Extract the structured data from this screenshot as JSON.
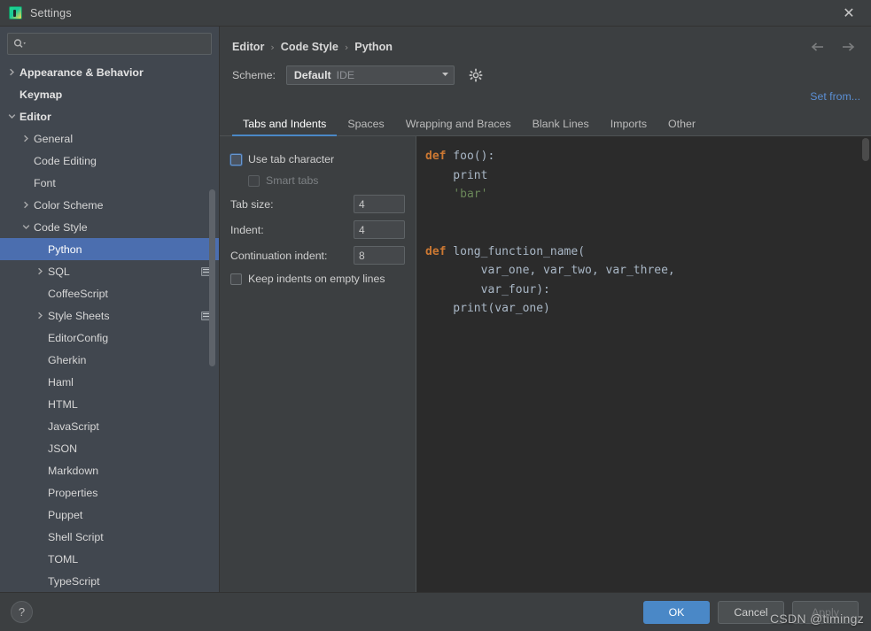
{
  "window": {
    "title": "Settings",
    "app_icon": "pycharm-icon",
    "close_label": "✕"
  },
  "sidebar": {
    "search": {
      "value": "",
      "placeholder": "",
      "icon": "search-icon"
    },
    "items": [
      {
        "label": "Appearance & Behavior",
        "depth": 0,
        "arrow": "collapsed",
        "bold": true,
        "selected": false,
        "badge": false
      },
      {
        "label": "Keymap",
        "depth": 0,
        "arrow": "none",
        "bold": true,
        "selected": false,
        "badge": false
      },
      {
        "label": "Editor",
        "depth": 0,
        "arrow": "expanded",
        "bold": true,
        "selected": false,
        "badge": false
      },
      {
        "label": "General",
        "depth": 1,
        "arrow": "collapsed",
        "bold": false,
        "selected": false,
        "badge": false
      },
      {
        "label": "Code Editing",
        "depth": 1,
        "arrow": "none",
        "bold": false,
        "selected": false,
        "badge": false
      },
      {
        "label": "Font",
        "depth": 1,
        "arrow": "none",
        "bold": false,
        "selected": false,
        "badge": false
      },
      {
        "label": "Color Scheme",
        "depth": 1,
        "arrow": "collapsed",
        "bold": false,
        "selected": false,
        "badge": false
      },
      {
        "label": "Code Style",
        "depth": 1,
        "arrow": "expanded",
        "bold": false,
        "selected": false,
        "badge": false
      },
      {
        "label": "Python",
        "depth": 2,
        "arrow": "none",
        "bold": false,
        "selected": true,
        "badge": false
      },
      {
        "label": "SQL",
        "depth": 2,
        "arrow": "collapsed",
        "bold": false,
        "selected": false,
        "badge": true
      },
      {
        "label": "CoffeeScript",
        "depth": 2,
        "arrow": "none",
        "bold": false,
        "selected": false,
        "badge": false
      },
      {
        "label": "Style Sheets",
        "depth": 2,
        "arrow": "collapsed",
        "bold": false,
        "selected": false,
        "badge": true
      },
      {
        "label": "EditorConfig",
        "depth": 2,
        "arrow": "none",
        "bold": false,
        "selected": false,
        "badge": false
      },
      {
        "label": "Gherkin",
        "depth": 2,
        "arrow": "none",
        "bold": false,
        "selected": false,
        "badge": false
      },
      {
        "label": "Haml",
        "depth": 2,
        "arrow": "none",
        "bold": false,
        "selected": false,
        "badge": false
      },
      {
        "label": "HTML",
        "depth": 2,
        "arrow": "none",
        "bold": false,
        "selected": false,
        "badge": false
      },
      {
        "label": "JavaScript",
        "depth": 2,
        "arrow": "none",
        "bold": false,
        "selected": false,
        "badge": false
      },
      {
        "label": "JSON",
        "depth": 2,
        "arrow": "none",
        "bold": false,
        "selected": false,
        "badge": false
      },
      {
        "label": "Markdown",
        "depth": 2,
        "arrow": "none",
        "bold": false,
        "selected": false,
        "badge": false
      },
      {
        "label": "Properties",
        "depth": 2,
        "arrow": "none",
        "bold": false,
        "selected": false,
        "badge": false
      },
      {
        "label": "Puppet",
        "depth": 2,
        "arrow": "none",
        "bold": false,
        "selected": false,
        "badge": false
      },
      {
        "label": "Shell Script",
        "depth": 2,
        "arrow": "none",
        "bold": false,
        "selected": false,
        "badge": false
      },
      {
        "label": "TOML",
        "depth": 2,
        "arrow": "none",
        "bold": false,
        "selected": false,
        "badge": false
      },
      {
        "label": "TypeScript",
        "depth": 2,
        "arrow": "none",
        "bold": false,
        "selected": false,
        "badge": false
      }
    ]
  },
  "breadcrumb": {
    "parts": [
      "Editor",
      "Code Style",
      "Python"
    ],
    "separator": "›",
    "back_icon": "arrow-left-icon",
    "forward_icon": "arrow-right-icon"
  },
  "scheme": {
    "label": "Scheme:",
    "value": "Default",
    "scope": "IDE",
    "gear_icon": "gear-icon",
    "dropdown_icon": "chevron-down-icon",
    "set_from_label": "Set from..."
  },
  "tabs": [
    {
      "label": "Tabs and Indents",
      "active": true
    },
    {
      "label": "Spaces",
      "active": false
    },
    {
      "label": "Wrapping and Braces",
      "active": false
    },
    {
      "label": "Blank Lines",
      "active": false
    },
    {
      "label": "Imports",
      "active": false
    },
    {
      "label": "Other",
      "active": false
    }
  ],
  "settings": {
    "use_tab_character": {
      "label": "Use tab character",
      "checked": false,
      "focused": true,
      "disabled": false
    },
    "smart_tabs": {
      "label": "Smart tabs",
      "checked": false,
      "focused": false,
      "disabled": true
    },
    "tab_size": {
      "label": "Tab size:",
      "value": "4"
    },
    "indent": {
      "label": "Indent:",
      "value": "4"
    },
    "continuation_indent": {
      "label": "Continuation indent:",
      "value": "8"
    },
    "keep_indents": {
      "label": "Keep indents on empty lines",
      "checked": false,
      "focused": false,
      "disabled": false
    }
  },
  "preview": {
    "lines": [
      [
        {
          "t": "def",
          "c": "kw"
        },
        {
          "t": " foo():",
          "c": ""
        }
      ],
      [
        {
          "t": "    print",
          "c": ""
        }
      ],
      [
        {
          "t": "    ",
          "c": ""
        },
        {
          "t": "'bar'",
          "c": "str"
        }
      ],
      [
        {
          "t": "",
          "c": ""
        }
      ],
      [
        {
          "t": "",
          "c": ""
        }
      ],
      [
        {
          "t": "def",
          "c": "kw"
        },
        {
          "t": " long_function_name(",
          "c": ""
        }
      ],
      [
        {
          "t": "        var_one, var_two, var_three,",
          "c": ""
        }
      ],
      [
        {
          "t": "        var_four):",
          "c": ""
        }
      ],
      [
        {
          "t": "    print(var_one)",
          "c": ""
        }
      ]
    ]
  },
  "footer": {
    "help_label": "?",
    "ok_label": "OK",
    "cancel_label": "Cancel",
    "apply_label": "Apply"
  },
  "watermark": {
    "text": "CSDN @timingz"
  },
  "colors": {
    "accent_blue": "#4a88c7",
    "selection_blue": "#4b6eaf",
    "sidebar_bg": "#41474f",
    "panel_bg": "#3c3f41",
    "editor_bg": "#2b2b2b",
    "keyword": "#cc7832",
    "string": "#6a8759",
    "link": "#5b8fd4"
  }
}
